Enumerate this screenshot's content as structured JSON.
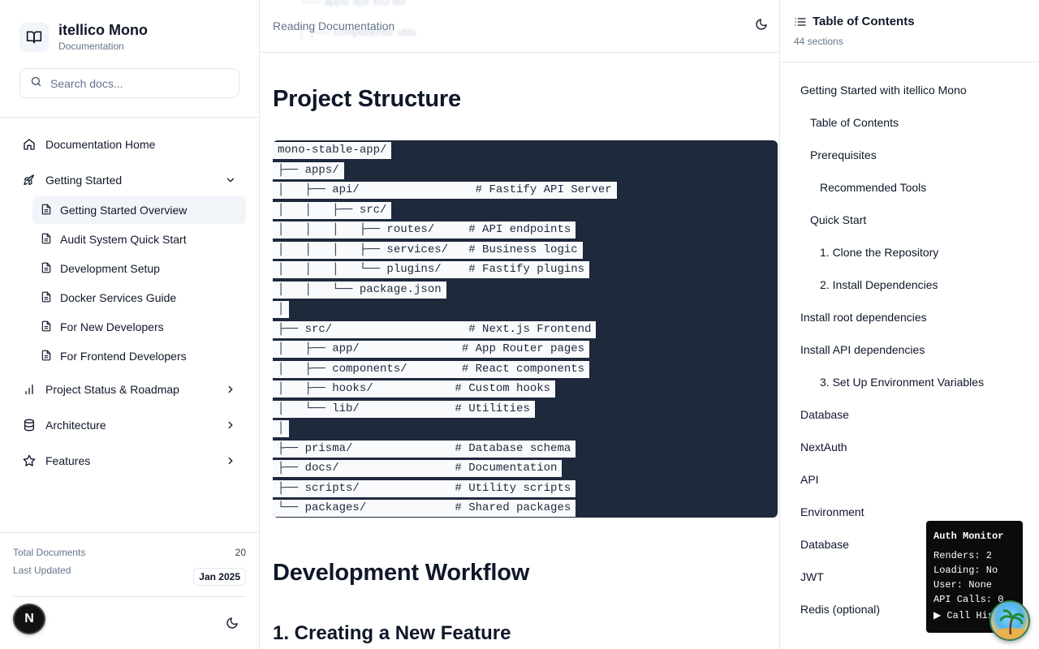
{
  "app": {
    "name": "itellico Mono",
    "subtitle": "Documentation",
    "book_icon": "book-open-icon"
  },
  "search": {
    "placeholder": "Search docs..."
  },
  "sidebar": {
    "items": [
      {
        "label": "Documentation Home",
        "icon": "home-icon"
      },
      {
        "label": "Getting Started",
        "icon": "rocket-icon",
        "expanded": true,
        "children": [
          {
            "label": "Getting Started Overview",
            "active": true
          },
          {
            "label": "Audit System Quick Start"
          },
          {
            "label": "Development Setup"
          },
          {
            "label": "Docker Services Guide"
          },
          {
            "label": "For New Developers"
          },
          {
            "label": "For Frontend Developers"
          }
        ]
      },
      {
        "label": "Project Status & Roadmap",
        "icon": "bar-chart-icon"
      },
      {
        "label": "Architecture",
        "icon": "database-icon"
      },
      {
        "label": "Features",
        "icon": "star-icon"
      }
    ],
    "stats": {
      "total_label": "Total Documents",
      "total_value": "20",
      "updated_label": "Last Updated",
      "updated_value": "Jan 2025"
    },
    "avatar_letter": "N"
  },
  "main": {
    "topbar_label": "Reading Documentation",
    "ghost_lines": [
      "└── apps/ api/ src/ lib/",
      "│   ├── components/ utils"
    ],
    "heading1": "Project Structure",
    "code_lines": [
      "mono-stable-app/",
      "├── apps/",
      "│   ├── api/                 # Fastify API Server",
      "│   │   ├── src/",
      "│   │   │   ├── routes/     # API endpoints",
      "│   │   │   ├── services/   # Business logic",
      "│   │   │   └── plugins/    # Fastify plugins",
      "│   │   └── package.json",
      "│",
      "├── src/                    # Next.js Frontend",
      "│   ├── app/               # App Router pages",
      "│   ├── components/        # React components",
      "│   ├── hooks/            # Custom hooks",
      "│   └── lib/              # Utilities",
      "│",
      "├── prisma/               # Database schema",
      "├── docs/                 # Documentation",
      "├── scripts/              # Utility scripts",
      "└── packages/             # Shared packages"
    ],
    "heading2": "Development Workflow",
    "heading3": "1. Creating a New Feature"
  },
  "toc": {
    "title": "Table of Contents",
    "count": "44 sections",
    "items": [
      {
        "label": "Getting Started with itellico Mono",
        "level": 1
      },
      {
        "label": "Table of Contents",
        "level": 2
      },
      {
        "label": "Prerequisites",
        "level": 2
      },
      {
        "label": "Recommended Tools",
        "level": 3
      },
      {
        "label": "Quick Start",
        "level": 2
      },
      {
        "label": "1. Clone the Repository",
        "level": 3
      },
      {
        "label": "2. Install Dependencies",
        "level": 3
      },
      {
        "label": "Install root dependencies",
        "level": 1
      },
      {
        "label": "Install API dependencies",
        "level": 1
      },
      {
        "label": "3. Set Up Environment Variables",
        "level": 3
      },
      {
        "label": "Database",
        "level": 1
      },
      {
        "label": "NextAuth",
        "level": 1
      },
      {
        "label": "API",
        "level": 1
      },
      {
        "label": "Environment",
        "level": 1
      },
      {
        "label": "Database",
        "level": 1
      },
      {
        "label": "JWT",
        "level": 1
      },
      {
        "label": "Redis (optional)",
        "level": 1
      }
    ]
  },
  "auth_monitor": {
    "title": "Auth Monitor",
    "rows": [
      "Renders: 2",
      "Loading: No",
      "User: None",
      "API Calls: 0"
    ],
    "call_history": "▶ Call History"
  }
}
